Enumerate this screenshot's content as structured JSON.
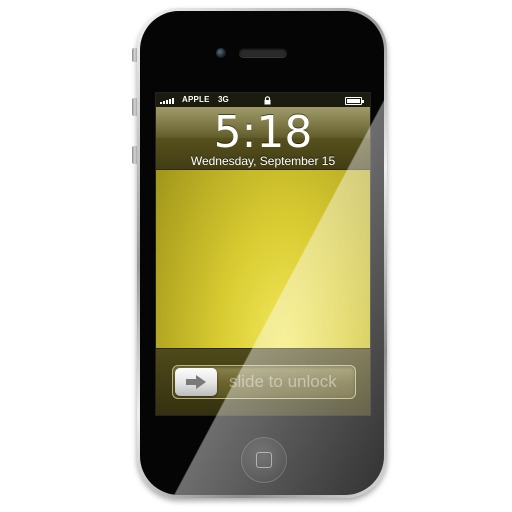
{
  "status_bar": {
    "carrier": "APPLE",
    "network": "3G",
    "lock_icon": "lock-icon",
    "signal_icon": "signal-bars-icon",
    "battery_icon": "battery-icon"
  },
  "lock_screen": {
    "time": "5:18",
    "date": "Wednesday, September 15",
    "slider_label": "slide to unlock",
    "slider_icon": "arrow-right-icon"
  },
  "hardware": {
    "home_button_icon": "home-square-icon"
  },
  "colors": {
    "wallpaper": "#d9cc32",
    "panel": "#57511d"
  }
}
